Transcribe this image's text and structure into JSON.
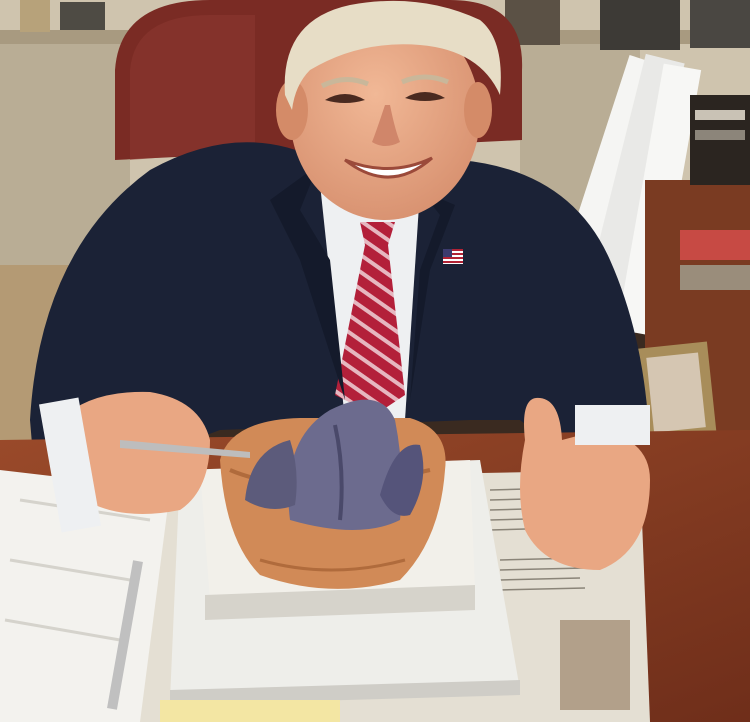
{
  "scene": {
    "palette": {
      "wall": "#cfc4ae",
      "shelf": "#b9ad95",
      "floor": "#b49a74",
      "chair": "#7a2b24",
      "suit": "#1b2236",
      "shirt": "#eef0f2",
      "tie_red": "#b3203a",
      "tie_stripe": "#e6b7c0",
      "skin": "#e9a783",
      "hair": "#e7ddc6",
      "desk": "#8a3b22",
      "napkin": "#f3f2ee",
      "plate": "#eeeeea",
      "bowl": "#f2f0ea",
      "shell": "#d18a57",
      "sausage": "#6c6b8e",
      "newspaper": "#e4dfd3",
      "note": "#f3e6a3"
    },
    "icons": [
      "flag-pin-icon"
    ]
  }
}
